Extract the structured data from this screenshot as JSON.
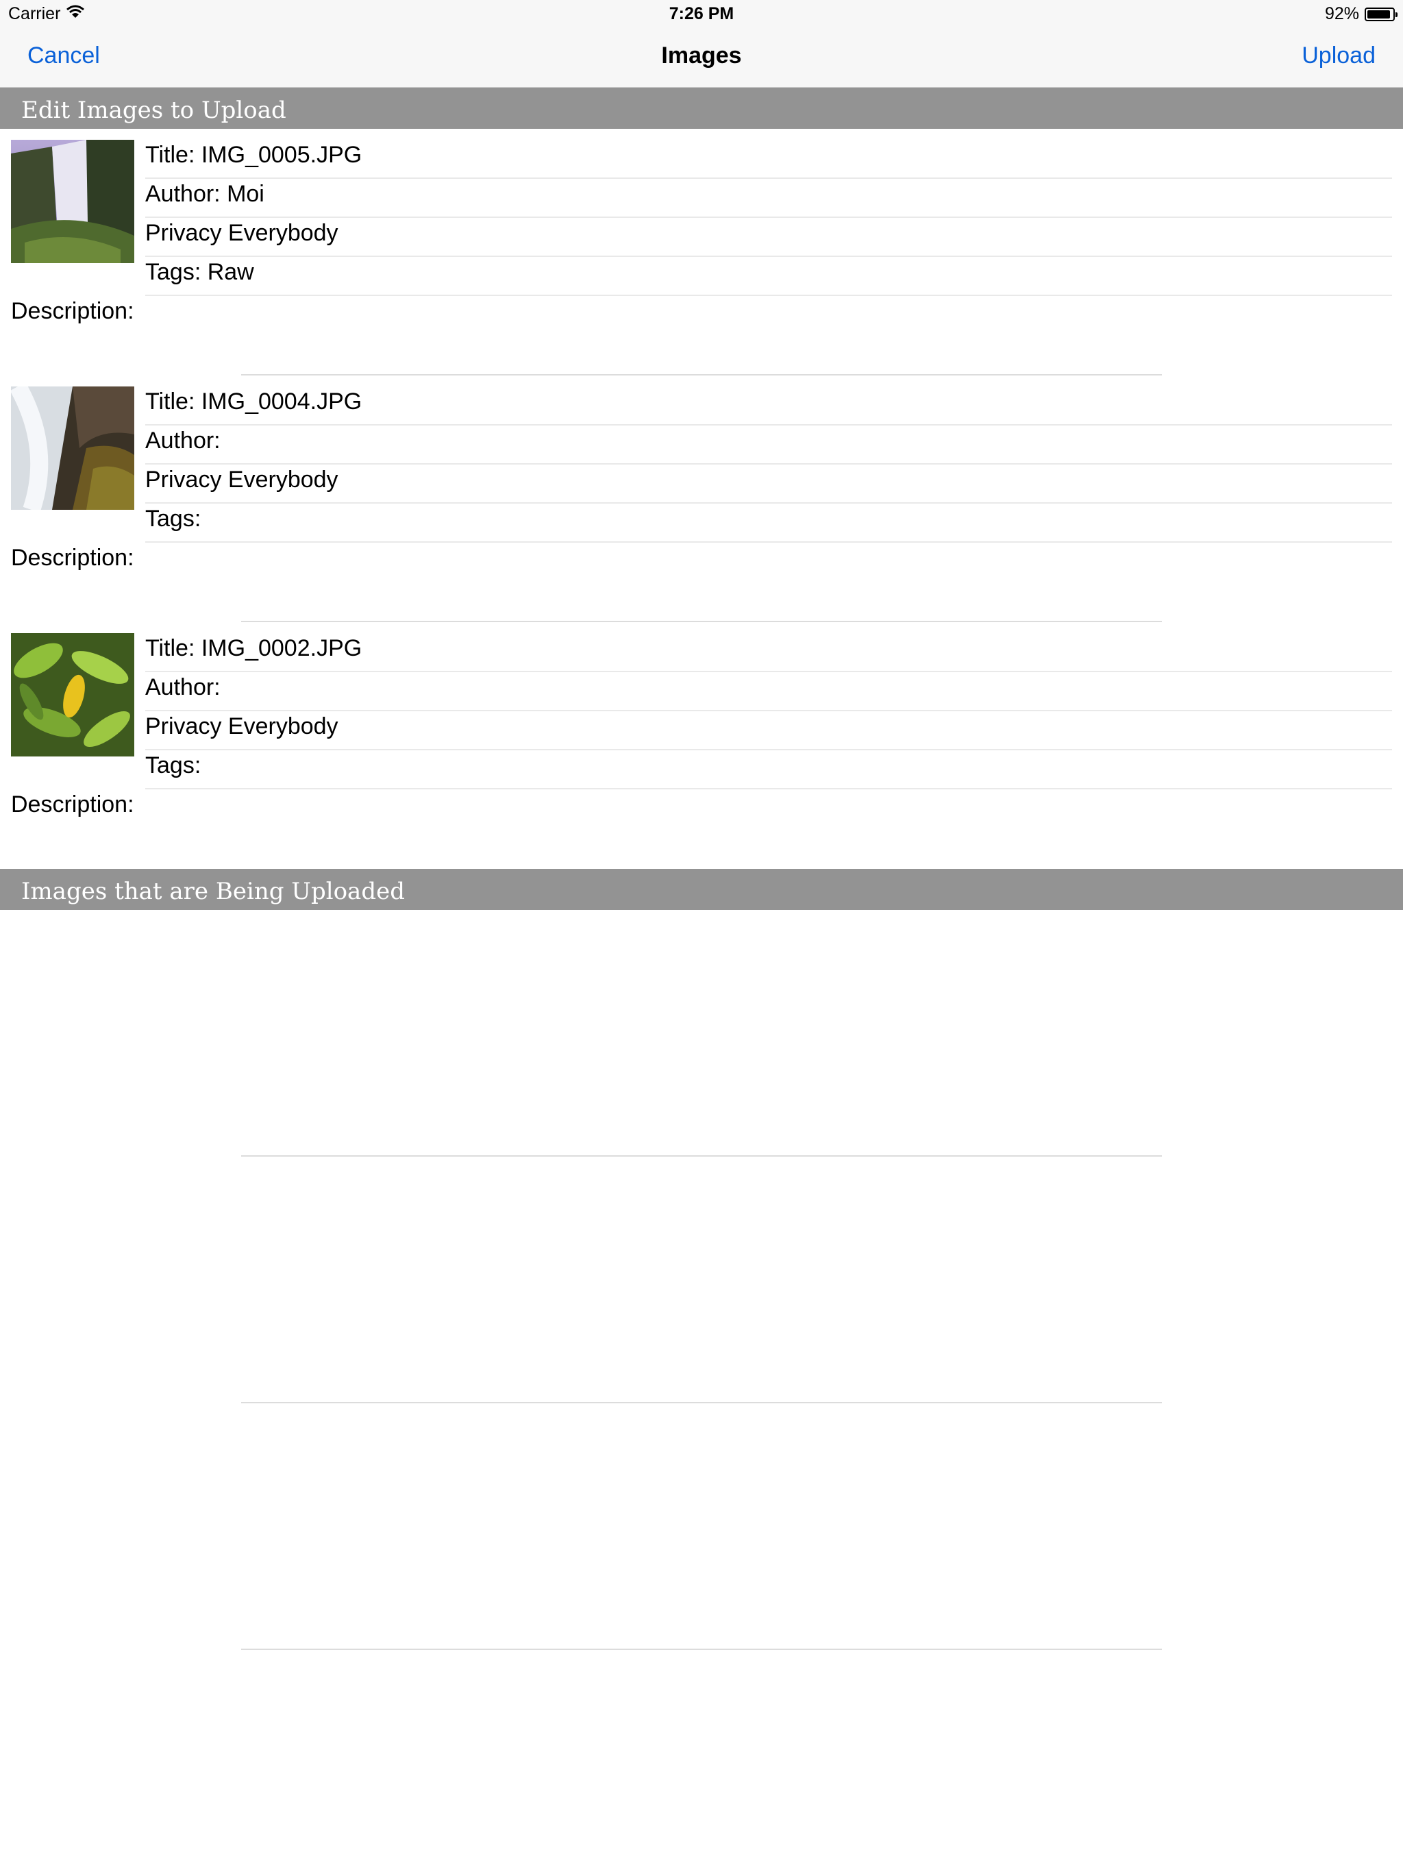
{
  "status_bar": {
    "carrier": "Carrier",
    "time": "7:26 PM",
    "battery": "92%",
    "battery_level": 0.92
  },
  "nav": {
    "cancel": "Cancel",
    "title": "Images",
    "upload": "Upload"
  },
  "sections": {
    "edit": "Edit Images to Upload",
    "uploading": "Images that are Being Uploaded"
  },
  "images": [
    {
      "title": "Title: IMG_0005.JPG",
      "author": "Author: Moi",
      "privacy": "Privacy Everybody",
      "tags": "Tags: Raw",
      "description": "Description:"
    },
    {
      "title": "Title: IMG_0004.JPG",
      "author": "Author:",
      "privacy": "Privacy Everybody",
      "tags": "Tags:",
      "description": "Description:"
    },
    {
      "title": "Title: IMG_0002.JPG",
      "author": "Author:",
      "privacy": "Privacy Everybody",
      "tags": "Tags:",
      "description": "Description:"
    }
  ]
}
